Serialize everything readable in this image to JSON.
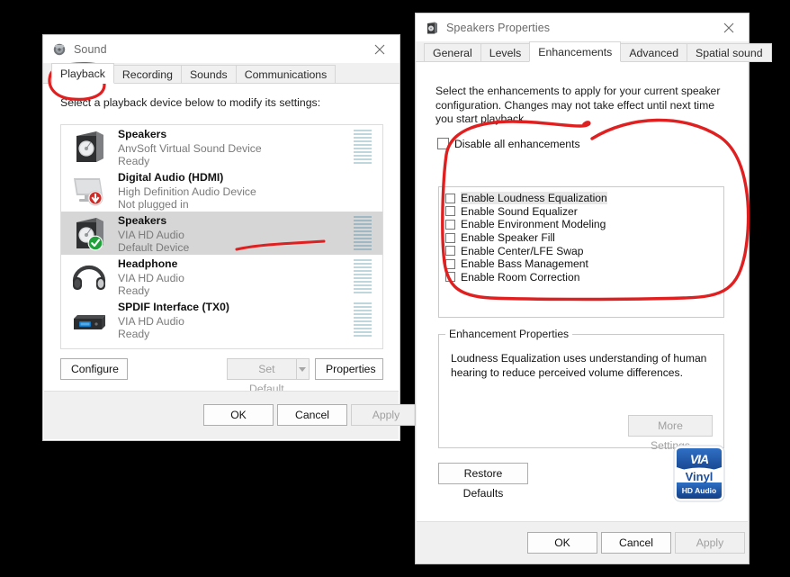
{
  "sound_window": {
    "title": "Sound",
    "icon": "speaker-window-icon",
    "close_label": "✕",
    "tabs": [
      {
        "label": "Playback",
        "active": true
      },
      {
        "label": "Recording",
        "active": false
      },
      {
        "label": "Sounds",
        "active": false
      },
      {
        "label": "Communications",
        "active": false
      }
    ],
    "hint": "Select a playback device below to modify its settings:",
    "devices": [
      {
        "name": "Speakers",
        "driver": "AnvSoft Virtual Sound Device",
        "status": "Ready",
        "icon": "speaker-icon",
        "selected": false,
        "badge": "none",
        "meter_level": 0
      },
      {
        "name": "Digital Audio (HDMI)",
        "driver": "High Definition Audio Device",
        "status": "Not plugged in",
        "icon": "monitor-icon",
        "selected": false,
        "badge": "unplugged-arrow-down",
        "meter_level": 0
      },
      {
        "name": "Speakers",
        "driver": "VIA HD Audio",
        "status": "Default Device",
        "icon": "speaker-icon",
        "selected": true,
        "badge": "default-check",
        "meter_level": 0
      },
      {
        "name": "Headphone",
        "driver": "VIA HD Audio",
        "status": "Ready",
        "icon": "headphone-icon",
        "selected": false,
        "badge": "none",
        "meter_level": 0
      },
      {
        "name": "SPDIF Interface (TX0)",
        "driver": "VIA HD Audio",
        "status": "Ready",
        "icon": "spdif-box-icon",
        "selected": false,
        "badge": "none",
        "meter_level": 0
      }
    ],
    "configure_label": "Configure",
    "set_default_label": "Set Default",
    "set_default_enabled": false,
    "properties_label": "Properties",
    "ok_label": "OK",
    "cancel_label": "Cancel",
    "apply_label": "Apply",
    "apply_enabled": false
  },
  "props_window": {
    "title": "Speakers Properties",
    "icon": "speaker-properties-icon",
    "close_label": "✕",
    "tabs": [
      {
        "label": "General",
        "active": false
      },
      {
        "label": "Levels",
        "active": false
      },
      {
        "label": "Enhancements",
        "active": true
      },
      {
        "label": "Advanced",
        "active": false
      },
      {
        "label": "Spatial sound",
        "active": false
      }
    ],
    "description": "Select the enhancements to apply for your current speaker configuration. Changes may not take effect until next time you start playback.",
    "disable_all": {
      "label": "Disable all enhancements",
      "checked": false
    },
    "enhancements": [
      {
        "label": "Enable Loudness Equalization",
        "checked": false,
        "highlighted": true
      },
      {
        "label": "Enable Sound Equalizer",
        "checked": false,
        "highlighted": false
      },
      {
        "label": "Enable Environment Modeling",
        "checked": false,
        "highlighted": false
      },
      {
        "label": "Enable Speaker Fill",
        "checked": false,
        "highlighted": false
      },
      {
        "label": "Enable Center/LFE Swap",
        "checked": false,
        "highlighted": false
      },
      {
        "label": "Enable Bass Management",
        "checked": false,
        "highlighted": false
      },
      {
        "label": "Enable Room Correction",
        "checked": false,
        "highlighted": false
      }
    ],
    "enhancement_properties": {
      "group_label": "Enhancement Properties",
      "text": "Loudness Equalization uses understanding of human hearing to reduce perceived volume differences.",
      "more_settings_label": "More Settings",
      "more_settings_enabled": false
    },
    "restore_defaults_label": "Restore Defaults",
    "logo": {
      "brand": "VIA",
      "line2": "Vinyl",
      "line3": "HD Audio"
    },
    "ok_label": "OK",
    "cancel_label": "Cancel",
    "apply_label": "Apply",
    "apply_enabled": false
  },
  "annotations": {
    "color": "#e02020",
    "marks": [
      {
        "name": "ellipse-around-playback-tab",
        "shape": "ellipse"
      },
      {
        "name": "underline-near-default-speakers",
        "shape": "line"
      },
      {
        "name": "ellipse-around-enhancements-list",
        "shape": "ellipse"
      }
    ]
  }
}
